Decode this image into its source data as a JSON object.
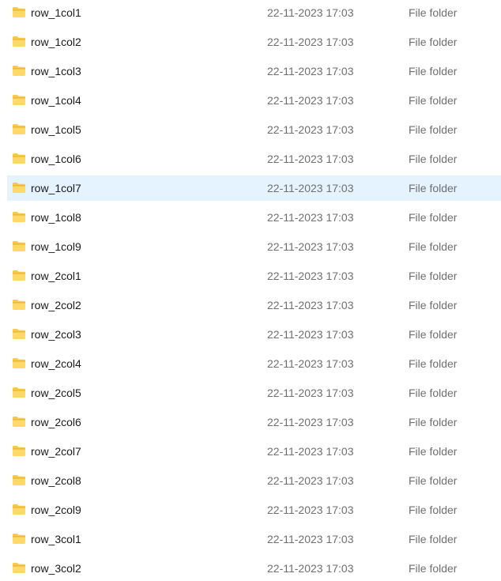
{
  "selected_index": 6,
  "rows": [
    {
      "name": "row_1col1",
      "date_modified": "22-11-2023 17:03",
      "type": "File folder",
      "icon": "folder-icon"
    },
    {
      "name": "row_1col2",
      "date_modified": "22-11-2023 17:03",
      "type": "File folder",
      "icon": "folder-icon"
    },
    {
      "name": "row_1col3",
      "date_modified": "22-11-2023 17:03",
      "type": "File folder",
      "icon": "folder-icon"
    },
    {
      "name": "row_1col4",
      "date_modified": "22-11-2023 17:03",
      "type": "File folder",
      "icon": "folder-icon"
    },
    {
      "name": "row_1col5",
      "date_modified": "22-11-2023 17:03",
      "type": "File folder",
      "icon": "folder-icon"
    },
    {
      "name": "row_1col6",
      "date_modified": "22-11-2023 17:03",
      "type": "File folder",
      "icon": "folder-icon"
    },
    {
      "name": "row_1col7",
      "date_modified": "22-11-2023 17:03",
      "type": "File folder",
      "icon": "folder-icon"
    },
    {
      "name": "row_1col8",
      "date_modified": "22-11-2023 17:03",
      "type": "File folder",
      "icon": "folder-icon"
    },
    {
      "name": "row_1col9",
      "date_modified": "22-11-2023 17:03",
      "type": "File folder",
      "icon": "folder-icon"
    },
    {
      "name": "row_2col1",
      "date_modified": "22-11-2023 17:03",
      "type": "File folder",
      "icon": "folder-icon"
    },
    {
      "name": "row_2col2",
      "date_modified": "22-11-2023 17:03",
      "type": "File folder",
      "icon": "folder-icon"
    },
    {
      "name": "row_2col3",
      "date_modified": "22-11-2023 17:03",
      "type": "File folder",
      "icon": "folder-icon"
    },
    {
      "name": "row_2col4",
      "date_modified": "22-11-2023 17:03",
      "type": "File folder",
      "icon": "folder-icon"
    },
    {
      "name": "row_2col5",
      "date_modified": "22-11-2023 17:03",
      "type": "File folder",
      "icon": "folder-icon"
    },
    {
      "name": "row_2col6",
      "date_modified": "22-11-2023 17:03",
      "type": "File folder",
      "icon": "folder-icon"
    },
    {
      "name": "row_2col7",
      "date_modified": "22-11-2023 17:03",
      "type": "File folder",
      "icon": "folder-icon"
    },
    {
      "name": "row_2col8",
      "date_modified": "22-11-2023 17:03",
      "type": "File folder",
      "icon": "folder-icon"
    },
    {
      "name": "row_2col9",
      "date_modified": "22-11-2023 17:03",
      "type": "File folder",
      "icon": "folder-icon"
    },
    {
      "name": "row_3col1",
      "date_modified": "22-11-2023 17:03",
      "type": "File folder",
      "icon": "folder-icon"
    },
    {
      "name": "row_3col2",
      "date_modified": "22-11-2023 17:03",
      "type": "File folder",
      "icon": "folder-icon"
    }
  ],
  "colors": {
    "selection_bg": "#e5f3ff",
    "folder_body": "#f8c846",
    "folder_front": "#ffd967",
    "name_text": "#1b1b1b",
    "meta_text": "#6f6f6f"
  }
}
